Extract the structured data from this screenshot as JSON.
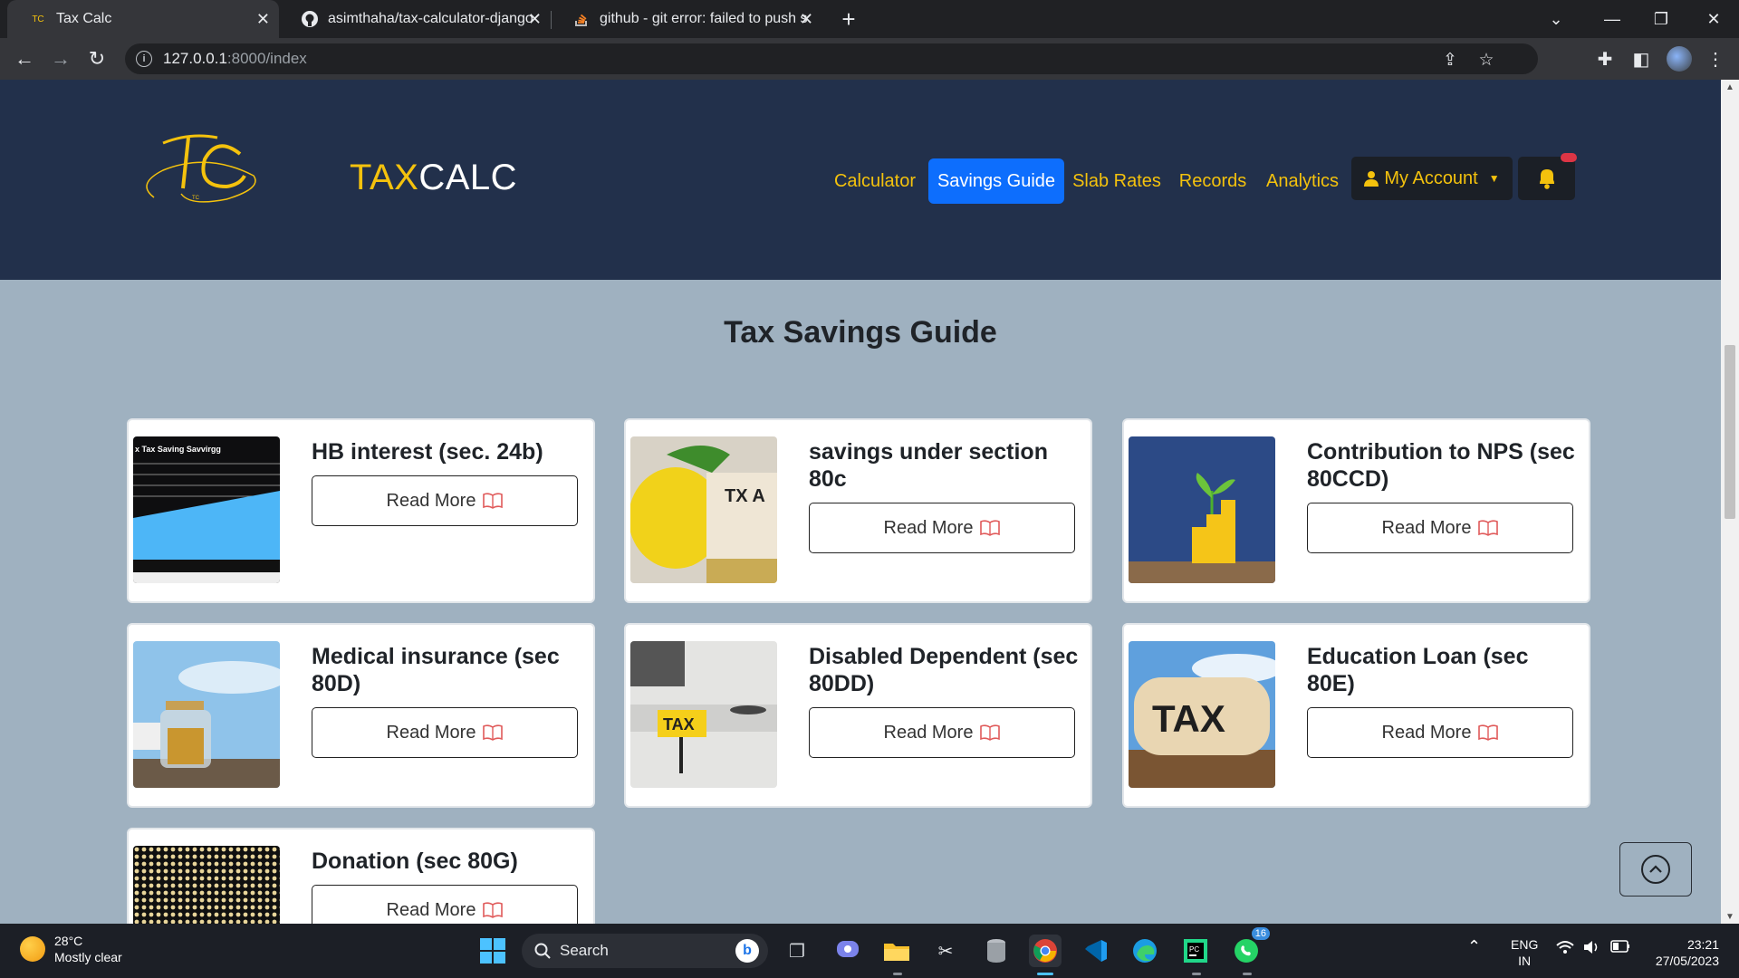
{
  "browser": {
    "tabs": [
      {
        "title": "Tax Calc",
        "icon": "taxcalc-favicon"
      },
      {
        "title": "asimthaha/tax-calculator-django",
        "icon": "github-icon"
      },
      {
        "title": "github - git error: failed to push s",
        "icon": "stackoverflow-icon"
      }
    ],
    "url_host": "127.0.0.1",
    "url_path": ":8000/index"
  },
  "site": {
    "brand_tax": "TAX",
    "brand_calc": "CALC",
    "logo_letters": "TC",
    "nav": [
      "Calculator",
      "Savings Guide",
      "Slab Rates",
      "Records",
      "Analytics"
    ],
    "active_nav": "Savings Guide",
    "account_label": "My Account",
    "accent": "#f4c20d",
    "active_color": "#0d6efd",
    "header_bg": "#22304b",
    "page_bg": "#9fb1c0"
  },
  "guide": {
    "heading": "Tax Savings Guide",
    "read_more": "Read More",
    "cards": [
      {
        "title": "HB interest (sec. 24b)",
        "image": "tax-saving-chart"
      },
      {
        "title": "savings under section 80c",
        "image": "lemon-tax-note"
      },
      {
        "title": "Contribution to NPS (sec 80CCD)",
        "image": "plant-on-bars"
      },
      {
        "title": "Medical insurance (sec 80D)",
        "image": "coin-jar"
      },
      {
        "title": "Disabled Dependent (sec 80DD)",
        "image": "tax-sign-desk"
      },
      {
        "title": "Education Loan (sec 80E)",
        "image": "wooden-tax-block"
      },
      {
        "title": "Donation (sec 80G)",
        "image": "coin-dots-pattern"
      }
    ],
    "chart_thumb_title": "x Tax Saving Savvirgg",
    "tax_sign_text": "TAX",
    "tax_block_text": "TAX",
    "tx_note_text": "TX A"
  },
  "taskbar": {
    "temp": "28°C",
    "weather": "Mostly clear",
    "search": "Search",
    "lang_top": "ENG",
    "lang_bottom": "IN",
    "time": "23:21",
    "date": "27/05/2023",
    "whatsapp_badge": "16"
  }
}
